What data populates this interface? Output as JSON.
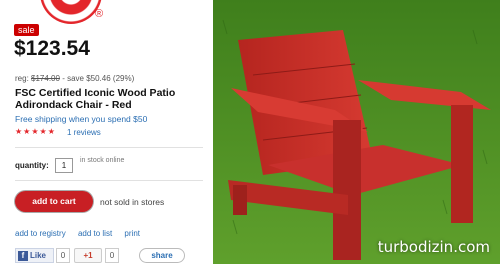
{
  "brand": {
    "registered_mark": "®",
    "logo_icon": "bullseye-logo-icon"
  },
  "product": {
    "sale_badge": "sale",
    "price": "$123.54",
    "reg_label": "reg:",
    "reg_price": "$174.00",
    "savings": "- save $50.46",
    "savings_pct": "(29%)",
    "title": "FSC Certified Iconic Wood Patio Adirondack Chair - Red",
    "shipping": "Free shipping when you spend $50",
    "rating_stars": "★★★★★",
    "rating": 5,
    "reviews_link": "1 reviews"
  },
  "purchase": {
    "quantity_label": "quantity:",
    "quantity_value": "1",
    "stock_status": "in stock online",
    "add_to_cart": "add to cart",
    "store_status": "not sold in stores"
  },
  "links": {
    "registry": "add to registry",
    "list": "add to list",
    "print": "print"
  },
  "social": {
    "like_label": "Like",
    "like_count": "0",
    "plus_label": "+1",
    "plus_count": "0",
    "share_label": "share"
  },
  "colors": {
    "brand_red": "#e3262b",
    "link_blue": "#2c6fb3",
    "chair_red": "#c8302d",
    "grass_green": "#4f8f24"
  },
  "watermark": "turbodizin.com"
}
